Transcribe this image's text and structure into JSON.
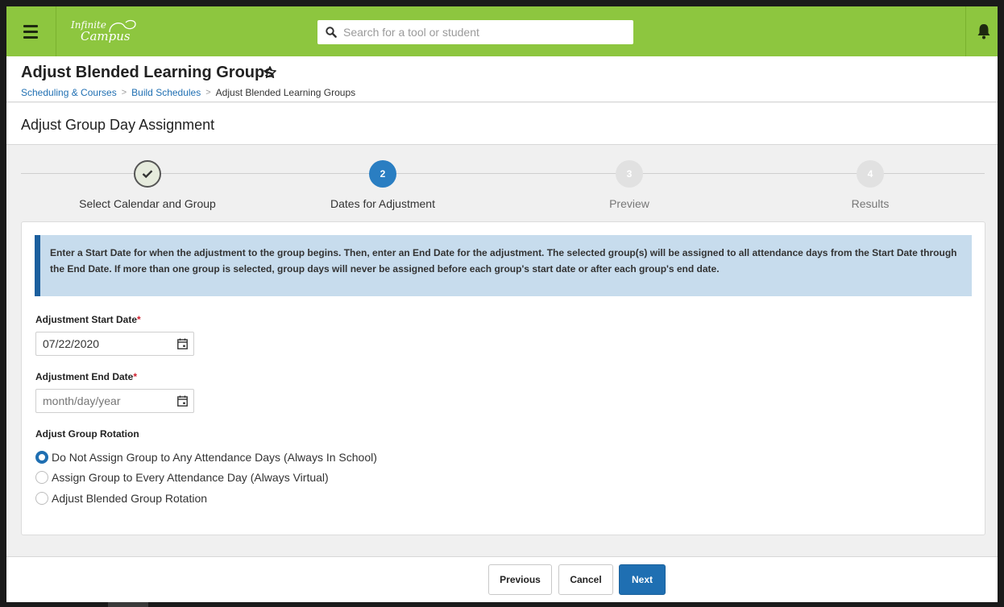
{
  "app": {
    "logo_line1": "Infinite",
    "logo_line2": "Campus",
    "search_placeholder": "Search for a tool or student",
    "brand_color": "#8dc63f"
  },
  "header": {
    "title": "Adjust Blended Learning Groups",
    "breadcrumb": [
      "Scheduling & Courses",
      "Build Schedules",
      "Adjust Blended Learning Groups"
    ]
  },
  "subheader": {
    "title": "Adjust Group Day Assignment"
  },
  "steps": [
    {
      "number": "",
      "label": "Select Calendar and Group",
      "state": "done",
      "icon": "checkmark-icon"
    },
    {
      "number": "2",
      "label": "Dates for Adjustment",
      "state": "active"
    },
    {
      "number": "3",
      "label": "Preview",
      "state": "pending"
    },
    {
      "number": "4",
      "label": "Results",
      "state": "pending"
    }
  ],
  "info_text": "Enter a Start Date for when the adjustment to the group begins. Then, enter an End Date for the adjustment. The selected group(s) will be assigned to all attendance days from the Start Date through the End Date. If more than one group is selected, group days will never be assigned before each group's start date or after each group's end date.",
  "form": {
    "start_label": "Adjustment Start Date",
    "start_value": "07/22/2020",
    "end_label": "Adjustment End Date",
    "end_placeholder": "month/day/year",
    "required_mark": "*",
    "rotation_label": "Adjust Group Rotation",
    "rotation_options": [
      {
        "label": "Do Not Assign Group to Any Attendance Days (Always In School)",
        "selected": true
      },
      {
        "label": "Assign Group to Every Attendance Day (Always Virtual)",
        "selected": false
      },
      {
        "label": "Adjust Blended Group Rotation",
        "selected": false
      }
    ]
  },
  "footer": {
    "previous_label": "Previous",
    "cancel_label": "Cancel",
    "next_label": "Next"
  },
  "colors": {
    "accent": "#1f6fb2",
    "info_bg": "#c7dced",
    "info_border": "#1b5f9e",
    "required": "#d0202e"
  }
}
